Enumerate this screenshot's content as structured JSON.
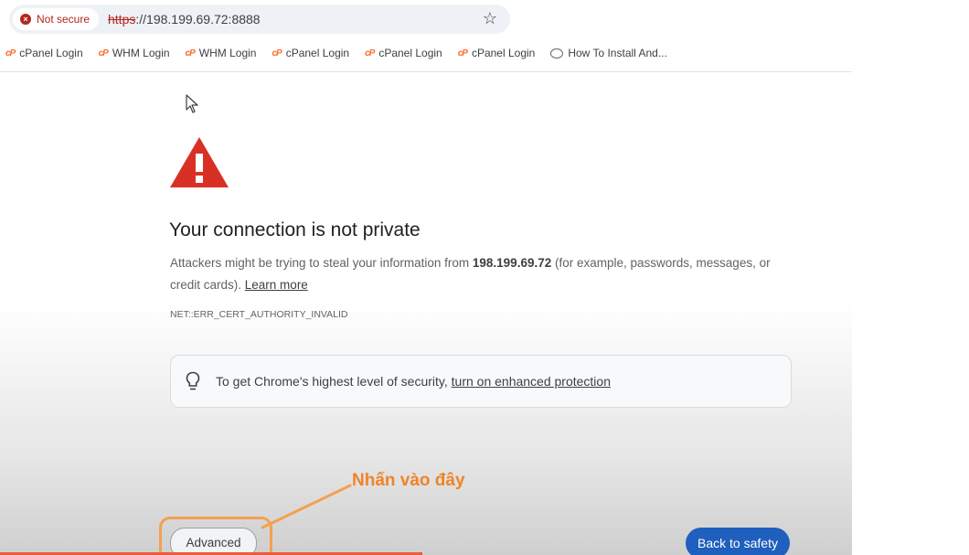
{
  "browser": {
    "security_chip": "Not secure",
    "url_scheme": "https",
    "url_rest": "://198.199.69.72:8888",
    "bookmarks": [
      {
        "label": "cPanel Login",
        "icon": "cpanel-icon"
      },
      {
        "label": "WHM Login",
        "icon": "cpanel-icon"
      },
      {
        "label": "WHM Login",
        "icon": "cpanel-icon"
      },
      {
        "label": "cPanel Login",
        "icon": "cpanel-icon"
      },
      {
        "label": "cPanel Login",
        "icon": "cpanel-icon"
      },
      {
        "label": "cPanel Login",
        "icon": "cpanel-icon"
      },
      {
        "label": "How To Install And...",
        "icon": "globe-icon"
      }
    ]
  },
  "page": {
    "heading": "Your connection is not private",
    "body_prefix": "Attackers might be trying to steal your information from ",
    "host": "198.199.69.72",
    "body_suffix": " (for example, passwords, messages, or credit cards). ",
    "learn_more": "Learn more",
    "error_code": "NET::ERR_CERT_AUTHORITY_INVALID",
    "enhanced_prefix": "To get Chrome's highest level of security, ",
    "enhanced_link": "turn on enhanced protection",
    "advanced_label": "Advanced",
    "back_label": "Back to safety"
  },
  "annotation": {
    "text": "Nhấn vào đây",
    "color": "#f08427"
  },
  "colors": {
    "warning_red": "#d93025",
    "primary_blue": "#1f5fbd",
    "insecure_red": "#b3261e"
  }
}
